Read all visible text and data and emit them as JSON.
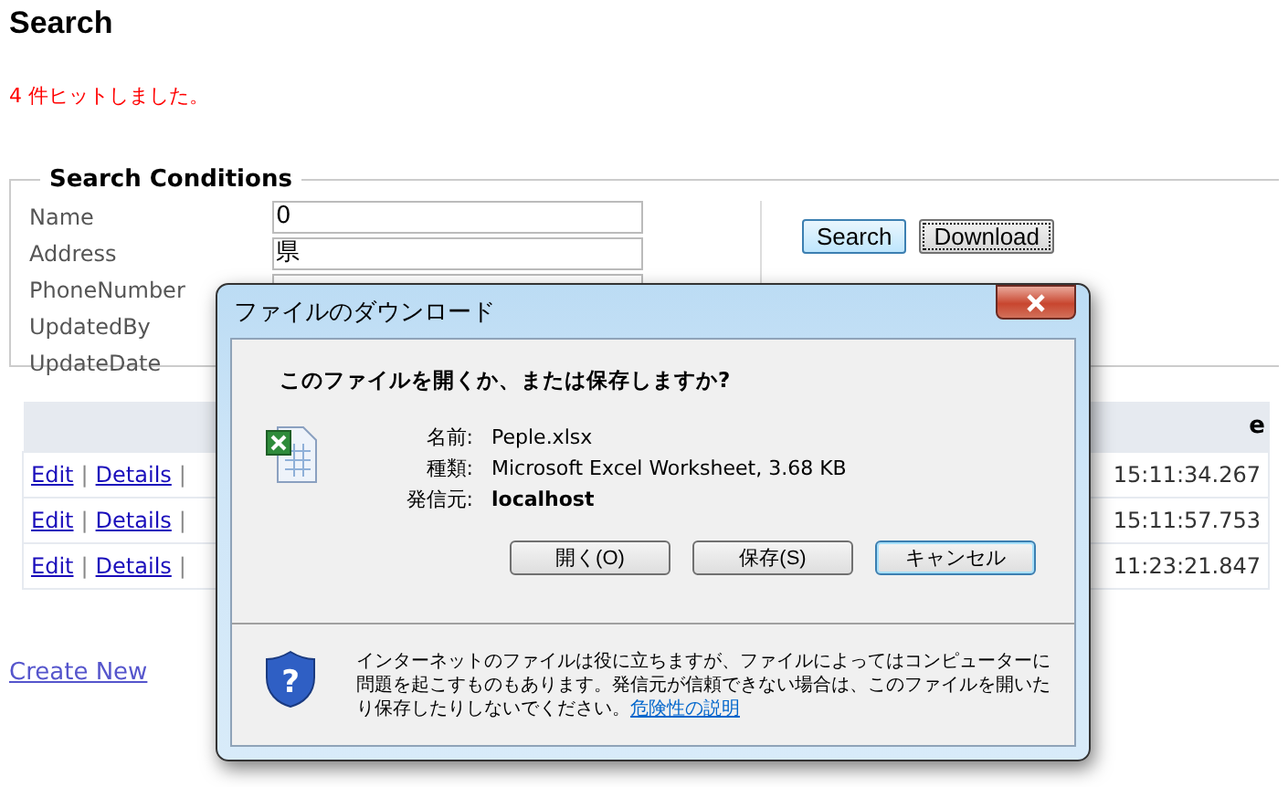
{
  "page": {
    "title": "Search",
    "message": "4 件ヒットしました。"
  },
  "search_conditions": {
    "legend": "Search Conditions",
    "fields": [
      {
        "label": "Name",
        "kind": "input",
        "value": "0"
      },
      {
        "label": "Address",
        "kind": "input",
        "value": "県"
      },
      {
        "label": "PhoneNumber",
        "kind": "input"
      },
      {
        "label": "UpdatedBy"
      },
      {
        "label": "UpdateDate"
      }
    ],
    "buttons": [
      {
        "label": "Search",
        "focused": false
      },
      {
        "label": "Download",
        "focused": true
      }
    ]
  },
  "table": {
    "columns": [
      {},
      {
        "label": "e"
      }
    ],
    "rows": [
      {
        "actions": [
          {
            "kind": "link",
            "text": "Edit"
          },
          {
            "kind": "separator",
            "text": "|"
          },
          {
            "kind": "link",
            "text": "Details"
          },
          {
            "kind": "separator",
            "text": "|"
          }
        ],
        "column_2": "15:11:34.267"
      },
      {
        "actions": [
          {
            "kind": "link",
            "text": "Edit"
          },
          {
            "kind": "separator",
            "text": "|"
          },
          {
            "kind": "link",
            "text": "Details"
          },
          {
            "kind": "separator",
            "text": "|"
          }
        ],
        "column_2": "15:11:57.753"
      },
      {
        "actions": [
          {
            "kind": "link",
            "text": "Edit"
          },
          {
            "kind": "separator",
            "text": "|"
          },
          {
            "kind": "link",
            "text": "Details"
          },
          {
            "kind": "separator",
            "text": "|"
          }
        ],
        "column_2": "11:23:21.847"
      }
    ]
  },
  "create_link": "Create New",
  "dialog": {
    "title": "ファイルのダウンロード",
    "question": "このファイルを開くか、または保存しますか?",
    "details": [
      {
        "label": "名前:",
        "value": "Peple.xlsx",
        "bold": false
      },
      {
        "label": "種類:",
        "value": "Microsoft Excel Worksheet, 3.68 KB",
        "bold": false
      },
      {
        "label": "発信元:",
        "value": "localhost",
        "bold": true
      }
    ],
    "buttons": [
      {
        "label": "開く(O)",
        "default": false
      },
      {
        "label": "保存(S)",
        "default": false
      },
      {
        "label": "キャンセル",
        "default": true
      }
    ],
    "warning": "インターネットのファイルは役に立ちますが、ファイルによってはコンピューターに問題を起こすものもあります。発信元が信頼できない場合は、このファイルを開いたり保存したりしないでください。",
    "warning_link": "危険性の説明",
    "warning_icon": "?"
  }
}
